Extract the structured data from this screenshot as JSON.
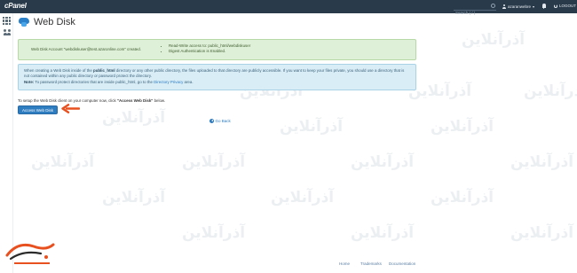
{
  "topbar": {
    "logo": "cPanel",
    "search_placeholder": "Search ( / )",
    "user": "azaranwebre",
    "logout": "LOGOUT"
  },
  "page": {
    "title": "Web Disk"
  },
  "success_alert": {
    "message": "Web Disk Account \"webdiskuser@test.azaronline.com\" created.",
    "bullets": [
      "Read-Write access to: public_html/webdiskuser",
      "Digest Authentication is Enabled."
    ]
  },
  "info_alert": {
    "p1_pre": "When creating a Web Disk inside of the ",
    "p1_bold": "public_html",
    "p1_post": " directory or any other public directory, the files uploaded to that directory are publicly accessible. If you want to keep your files private, you should use a directory that is not contained within any public directory or password protect the directory.",
    "p2_label": "Note:",
    "p2_text": " To password protect directories that are inside public_html, go to the ",
    "p2_link": "Directory Privacy",
    "p2_end": " area."
  },
  "instructions": {
    "pre": "To setup the Web Disk client on your computer now, click ",
    "bold": "\"Access Web Disk\"",
    "post": " below."
  },
  "access_button": "Access Web Disk",
  "go_back": "Go Back",
  "footer": {
    "links": [
      "Home",
      "Trademarks",
      "Documentation"
    ]
  },
  "watermark": {
    "text": "آذرآنلاین",
    "logo_text": "AZAR"
  },
  "colors": {
    "topbar": "#293a4a",
    "accent": "#2f7dc1",
    "arrow": "#e8501f"
  }
}
